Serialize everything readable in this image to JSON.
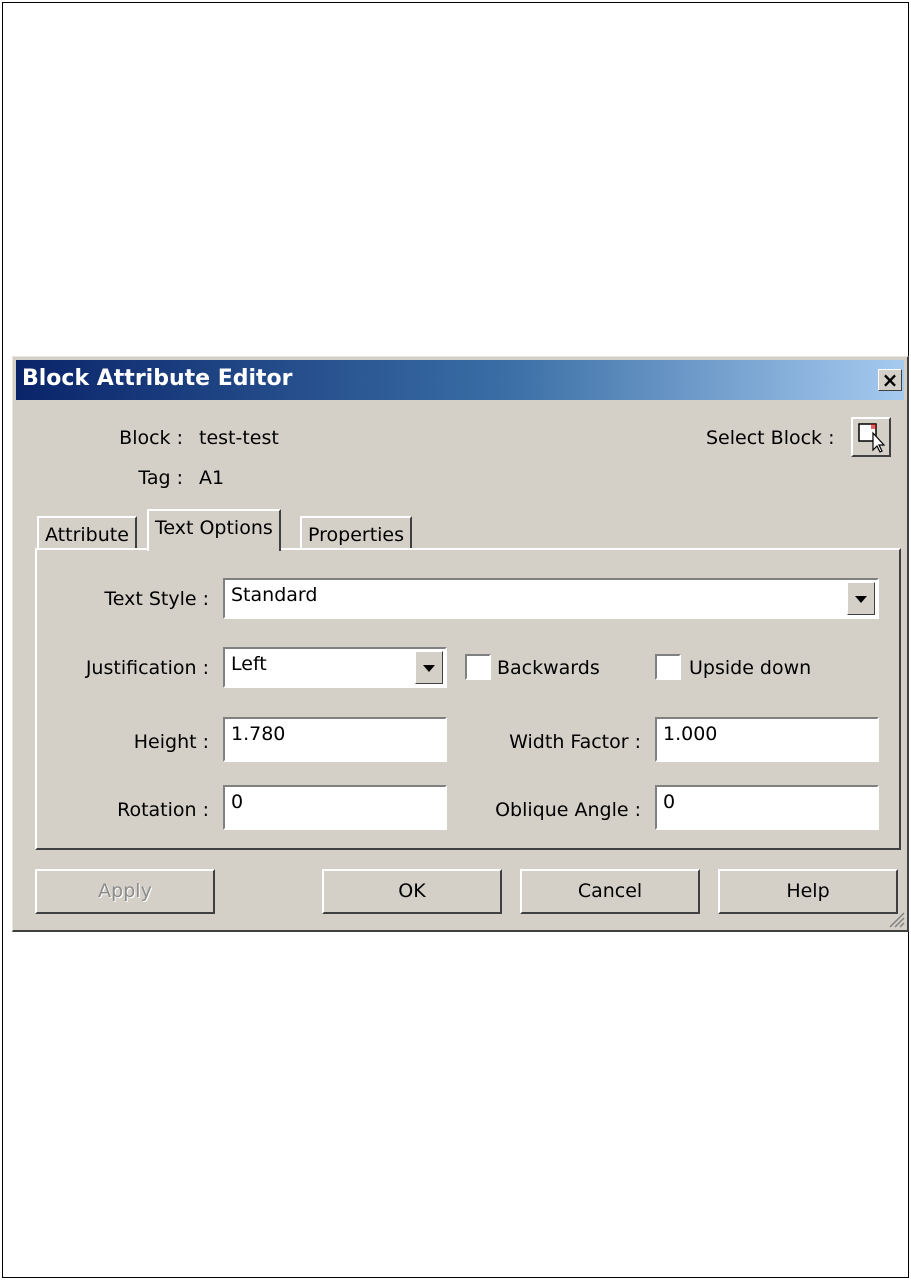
{
  "dialog": {
    "title": "Block Attribute Editor",
    "close_glyph": "×"
  },
  "header": {
    "block_label": "Block :",
    "block_value": "test-test",
    "tag_label": "Tag :",
    "tag_value": "A1",
    "select_block_label": "Select Block :",
    "select_block_icon": "select-block-icon"
  },
  "tabs": [
    {
      "label": "Attribute",
      "active": false
    },
    {
      "label": "Text Options",
      "active": true
    },
    {
      "label": "Properties",
      "active": false
    }
  ],
  "text_options": {
    "text_style_label": "Text Style :",
    "text_style_value": "Standard",
    "justification_label": "Justification :",
    "justification_value": "Left",
    "backwards_label": "Backwards",
    "backwards_checked": false,
    "upside_down_label": "Upside down",
    "upside_down_checked": false,
    "height_label": "Height :",
    "height_value": "1.780",
    "width_factor_label": "Width Factor :",
    "width_factor_value": "1.000",
    "rotation_label": "Rotation :",
    "rotation_value": "0",
    "oblique_angle_label": "Oblique Angle :",
    "oblique_angle_value": "0"
  },
  "buttons": {
    "apply": "Apply",
    "ok": "OK",
    "cancel": "Cancel",
    "help": "Help"
  }
}
